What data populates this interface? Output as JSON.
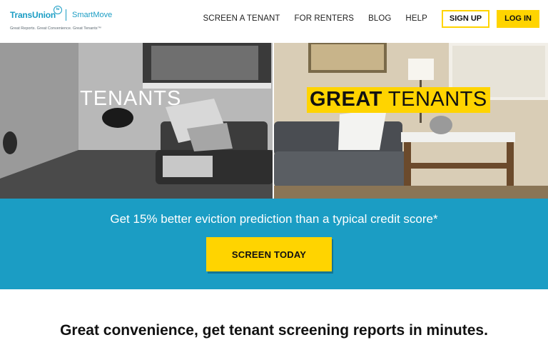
{
  "logo": {
    "brand": "TransUnion",
    "badge": "tu",
    "product": "SmartMove",
    "tagline": "Great Reports. Great Convenience. Great Tenants™"
  },
  "nav": {
    "items": [
      "SCREEN A TENANT",
      "FOR RENTERS",
      "BLOG",
      "HELP"
    ],
    "signup_label": "SIGN UP",
    "login_label": "LOG IN"
  },
  "hero": {
    "left_label": "TENANTS",
    "right_label_bold": "GREAT",
    "right_label_rest": " TENANTS"
  },
  "banner": {
    "text": "Get 15% better eviction prediction than a typical credit score*",
    "cta_label": "SCREEN TODAY"
  },
  "section": {
    "headline_bold": "Great convenience",
    "headline_rest": ", get tenant screening reports in minutes."
  },
  "colors": {
    "brand_blue": "#1b9dc4",
    "accent_yellow": "#ffd400"
  }
}
